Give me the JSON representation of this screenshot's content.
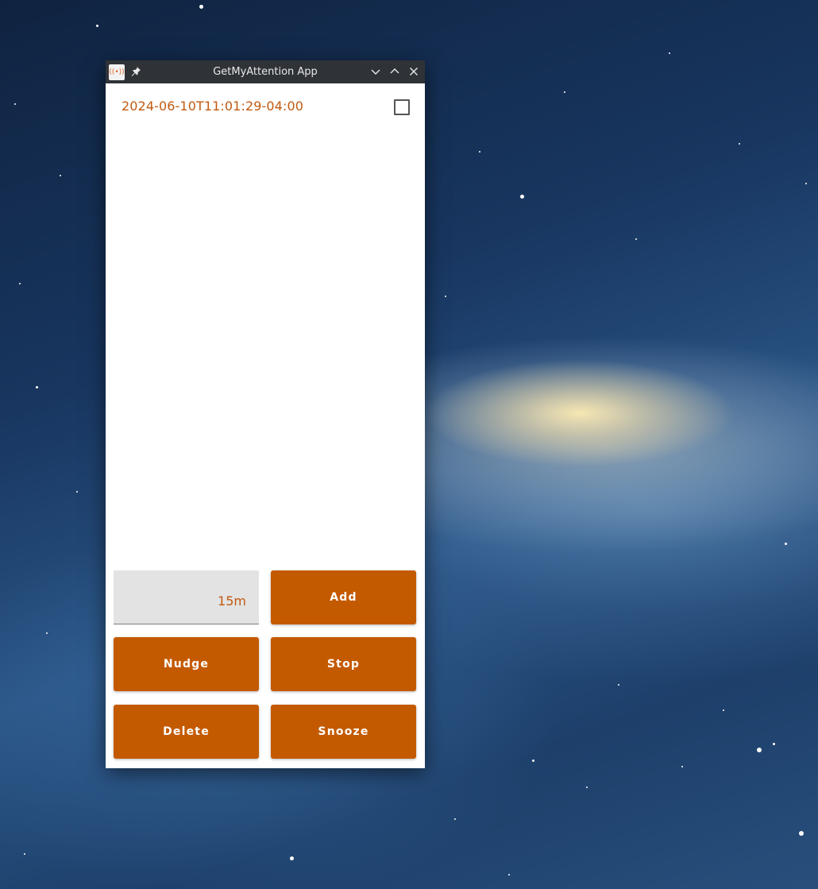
{
  "window": {
    "title": "GetMyAttention App"
  },
  "list": {
    "items": [
      {
        "label": "2024-06-10T11:01:29-04:00",
        "checked": false
      }
    ]
  },
  "controls": {
    "duration_value": "15m",
    "add_label": "Add",
    "nudge_label": "Nudge",
    "stop_label": "Stop",
    "delete_label": "Delete",
    "snooze_label": "Snooze"
  },
  "colors": {
    "accent": "#c45a00",
    "text_accent": "#c15a11",
    "titlebar": "#2f3237"
  }
}
